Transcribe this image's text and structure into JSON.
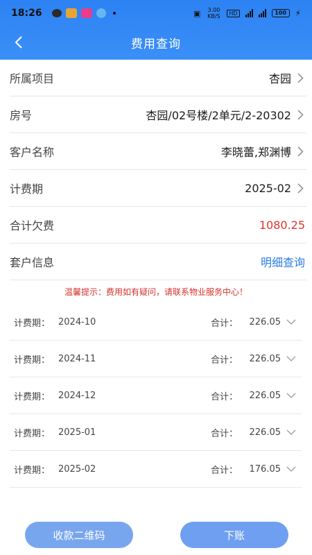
{
  "status_bar": {
    "time": "18:26",
    "speed": "3.00 KB/S",
    "hd": "HD",
    "battery": "100"
  },
  "header": {
    "title": "费用查询"
  },
  "info": [
    {
      "label": "所属项目",
      "value": "杏园",
      "arrow": true,
      "style": "normal"
    },
    {
      "label": "房号",
      "value": "杏园/02号楼/2单元/2-20302",
      "arrow": true,
      "style": "normal"
    },
    {
      "label": "客户名称",
      "value": "李晓蕾,郑渊博",
      "arrow": true,
      "style": "normal"
    },
    {
      "label": "计费期",
      "value": "2025-02",
      "arrow": true,
      "style": "normal"
    },
    {
      "label": "合计欠费",
      "value": "1080.25",
      "arrow": false,
      "style": "red"
    },
    {
      "label": "套户信息",
      "value": "明细查询",
      "arrow": false,
      "style": "link"
    }
  ],
  "notice": "温馨提示：费用如有疑问，请联系物业服务中心！",
  "periods": [
    {
      "period_label": "计费期：",
      "period": "2024-10",
      "total_label": "合计：",
      "total": "226.05"
    },
    {
      "period_label": "计费期：",
      "period": "2024-11",
      "total_label": "合计：",
      "total": "226.05"
    },
    {
      "period_label": "计费期：",
      "period": "2024-12",
      "total_label": "合计：",
      "total": "226.05"
    },
    {
      "period_label": "计费期：",
      "period": "2025-01",
      "total_label": "合计：",
      "total": "226.05"
    },
    {
      "period_label": "计费期：",
      "period": "2025-02",
      "total_label": "合计：",
      "total": "176.05"
    }
  ],
  "buttons": {
    "qr": "收款二维码",
    "order": "下账"
  },
  "colors": {
    "header_blue": "#2d82f4",
    "debt_red": "#e0322e",
    "link_blue": "#2c7de6",
    "button_blue": "#78a6ee"
  }
}
